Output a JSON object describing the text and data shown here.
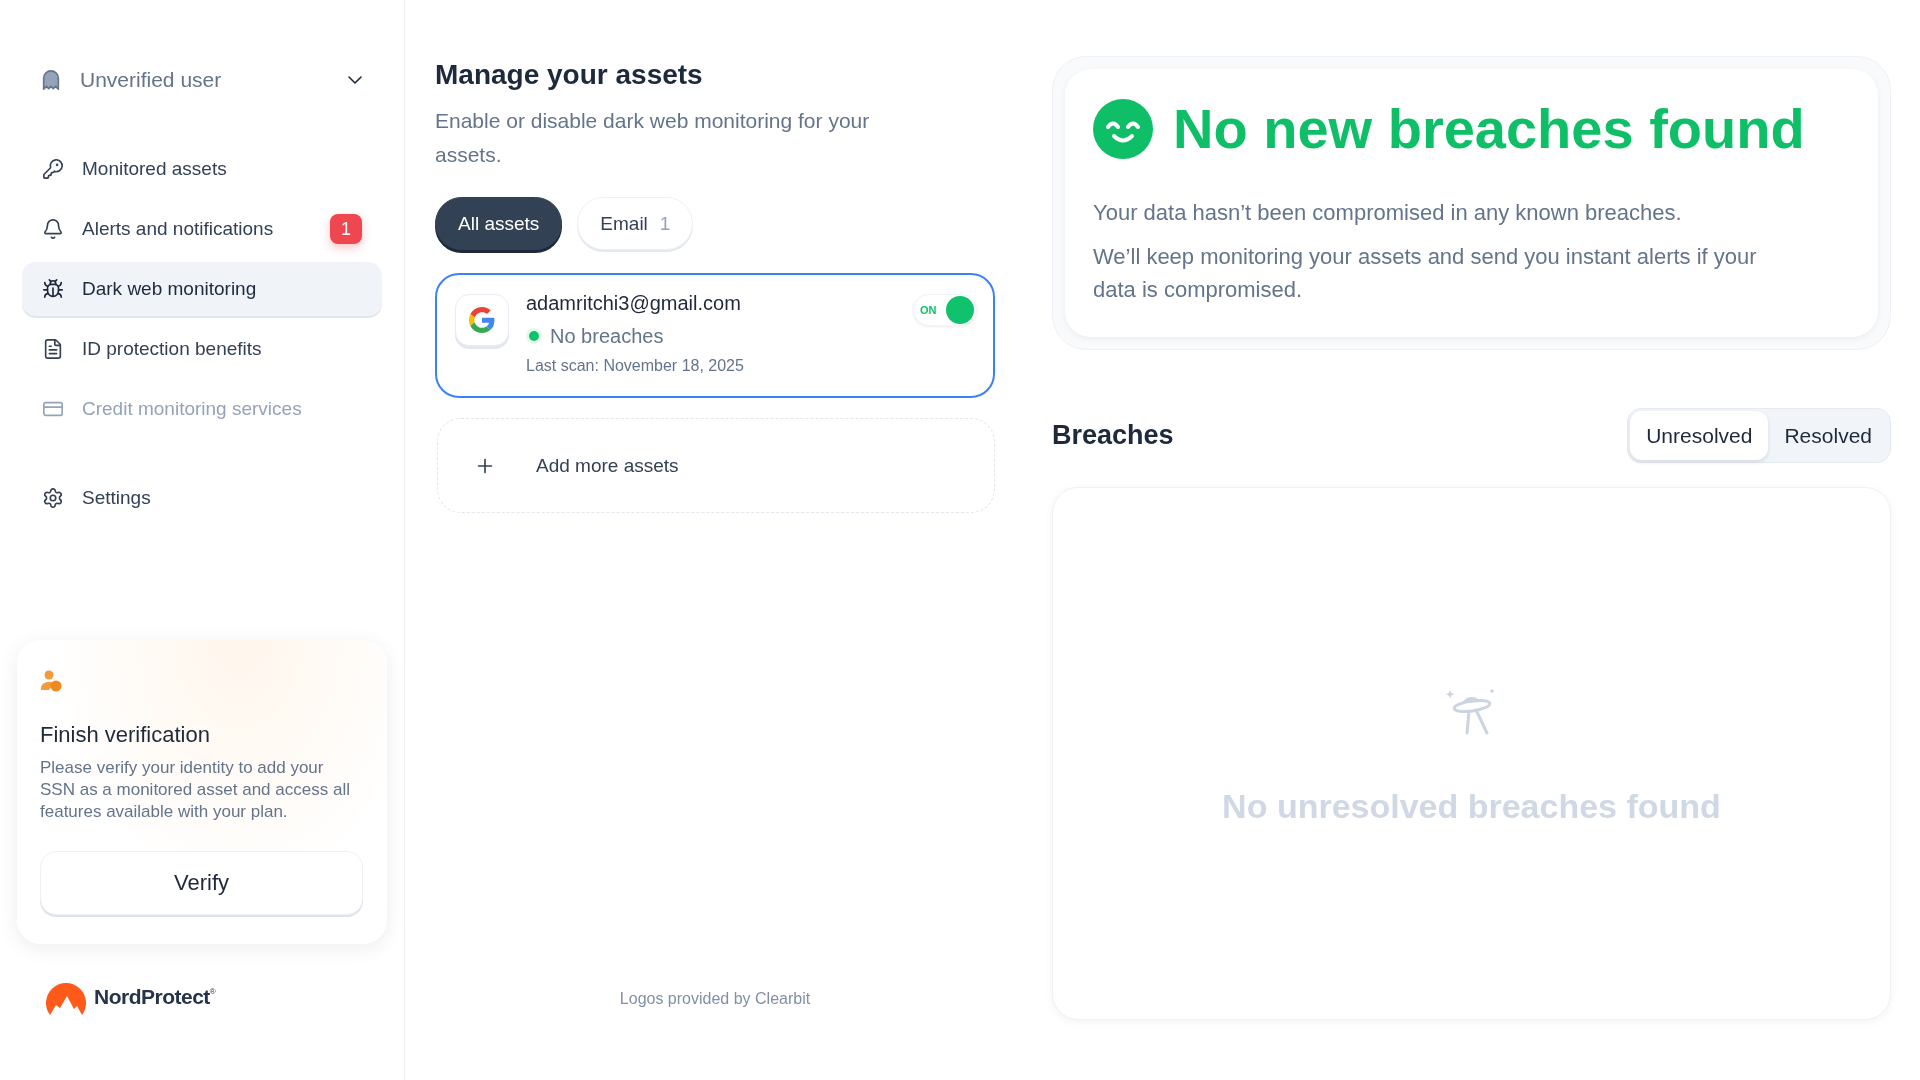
{
  "sidebar": {
    "user": {
      "name": "Unverified user",
      "expanded": false
    },
    "nav": [
      {
        "label": "Monitored assets",
        "selected": false,
        "disabled": false
      },
      {
        "label": "Alerts and notifications",
        "badge": "1",
        "selected": false,
        "disabled": false
      },
      {
        "label": "Dark web monitoring",
        "selected": true,
        "disabled": false
      },
      {
        "label": "ID protection benefits",
        "selected": false,
        "disabled": false
      },
      {
        "label": "Credit monitoring services",
        "selected": false,
        "disabled": true
      }
    ],
    "secondary_nav": [
      {
        "label": "Settings",
        "selected": false,
        "disabled": false
      }
    ],
    "verification": {
      "title": "Finish verification",
      "text": "Please verify your identity to add your SSN as a monitored asset and access all features available with your plan.",
      "button": "Verify"
    },
    "logo": {
      "text": "NordProtect$^{®}$"
    }
  },
  "assets": {
    "title": "Manage your assets",
    "subtitle": "Enable or disable dark web monitoring for your assets.",
    "filters": [
      {
        "label": "All assets",
        "selected": true
      },
      {
        "label": "Email",
        "count": "1",
        "selected": false
      }
    ],
    "items": [
      {
        "email": "adamritchi3@gmail.com",
        "status": "No breaches",
        "last_scan": "Last scan: November 18, 2025",
        "toggle_label": "ON",
        "on": true,
        "selected": true
      }
    ],
    "add_label": "Add more assets",
    "footnote": "Logos provided by Clearbit"
  },
  "summary": {
    "title": "No new breaches found",
    "paragraphs": [
      "Your data hasn’t been compromised in any known breaches.",
      "We’ll keep monitoring your assets and send you instant alerts if your data is compromised."
    ]
  },
  "breaches": {
    "title": "Breaches",
    "tabs": [
      {
        "label": "Unresolved",
        "selected": true
      },
      {
        "label": "Resolved",
        "selected": false
      }
    ],
    "empty_text": "No unresolved breaches found"
  }
}
